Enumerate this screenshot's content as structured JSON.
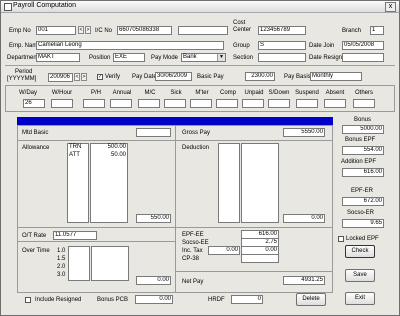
{
  "window": {
    "title": "Payroll Computation",
    "close_label": "x"
  },
  "employee": {
    "emp_no_label": "Emp No",
    "emp_no": "001",
    "ic_no_label": "I/C No",
    "ic_no": "660705086338",
    "cost_center_label": "Cost Center",
    "cost_center": "123456789",
    "branch_label": "Branch",
    "branch": "1",
    "emp_name_label": "Emp. Name",
    "emp_name": "Camelian Leong",
    "group_label": "Group",
    "group": "S",
    "date_join_label": "Date Join",
    "date_join": "05/05/2008",
    "department_label": "Department",
    "department": "MAKT",
    "position_label": "Position",
    "position": "EXE",
    "pay_mode_label": "Pay Mode",
    "pay_mode": "Bank",
    "section_label": "Section",
    "section": "",
    "date_resign_label": "Date Resign",
    "date_resign": ""
  },
  "period": {
    "period_label": "Period",
    "period_format": "[YYYYMM]",
    "period": "200906",
    "verify_label": "Verify",
    "verify_checked": true,
    "pay_date_label": "Pay Date",
    "pay_date": "30/06/2009",
    "basic_pay_label": "Basic Pay",
    "basic_pay": "2300.00",
    "pay_basis_label": "Pay Basis",
    "pay_basis": "Monthly"
  },
  "attendance": {
    "columns": [
      "W/Day",
      "W/Hour",
      "P/H",
      "Annual",
      "M/C",
      "Sick",
      "M'ter",
      "Comp",
      "Unpaid",
      "S/Down",
      "Suspend",
      "Absent",
      "Others"
    ],
    "values": [
      "26",
      "",
      "",
      "",
      "",
      "",
      "",
      "",
      "",
      "",
      "",
      "",
      ""
    ]
  },
  "earnings": {
    "mtd_basic_label": "Mtd Basic",
    "mtd_basic": "",
    "allowance_label": "Allowance",
    "allowance_codes": [
      "TRN",
      "ATT",
      "",
      "",
      ""
    ],
    "allowance_amounts": [
      "500.00",
      "50.00",
      "",
      "",
      ""
    ],
    "allowance_total": "550.00",
    "ot_rate_label": "O/T Rate",
    "ot_rate": "11.0577",
    "overtime_label": "Over Time",
    "overtime_rates": [
      "1.0",
      "1.5",
      "2.0",
      "3.0"
    ],
    "overtime_total": "0.00"
  },
  "deductions": {
    "gross_pay_label": "Gross Pay",
    "gross_pay": "5550.00",
    "deduction_label": "Deduction",
    "deduction_total": "0.00",
    "epf_ee_label": "EPF-EE",
    "epf_ee": "616.00",
    "socso_ee_label": "Socso-EE",
    "socso_ee": "2.75",
    "inc_tax_label": "Inc. Tax",
    "inc_tax_a": "0.00",
    "inc_tax_b": "0.00",
    "cp38_label": "CP-38",
    "cp38": "",
    "net_pay_label": "Net Pay",
    "net_pay": "4931.25"
  },
  "right_panel": {
    "bonus_label": "Bonus",
    "bonus": "5000.00",
    "bonus_epf_label": "Bonus EPF",
    "bonus_epf": "554.00",
    "addition_epf_label": "Addition EPF",
    "addition_epf": "616.00",
    "epf_er_label": "EPF-ER",
    "epf_er": "672.00",
    "socso_er_label": "Socso-ER",
    "socso_er": "9.65",
    "locked_epf_label": "Locked EPF",
    "check_label": "Check",
    "save_label": "Save",
    "exit_label": "Exit"
  },
  "footer": {
    "include_resigned_label": "Include Resigned",
    "bonus_pcb_label": "Bonus PCB",
    "bonus_pcb": "0.00",
    "hrdf_label": "HRDF",
    "hrdf": "0",
    "delete_label": "Delete"
  },
  "colors": {
    "accent_bar": "#0000c8"
  }
}
